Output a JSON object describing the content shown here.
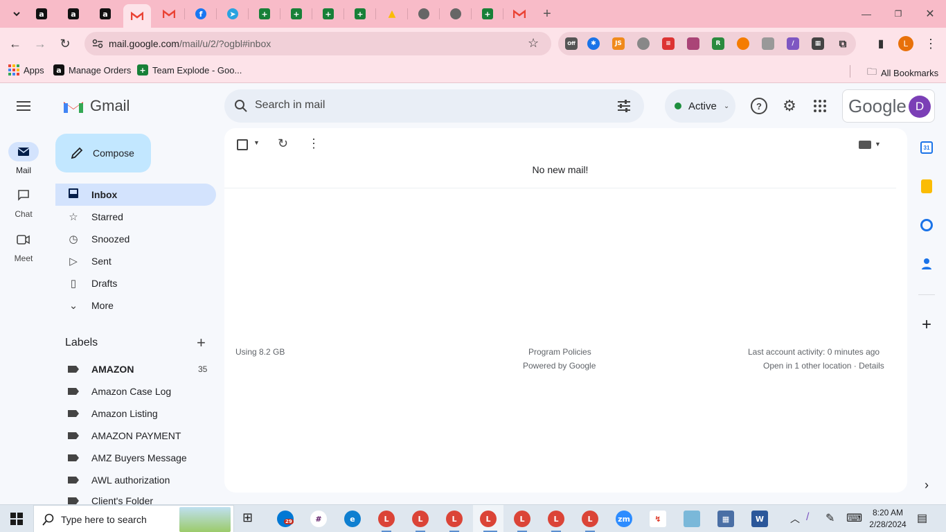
{
  "browser": {
    "tab_new": "+",
    "tab_letters": {
      "amazon": "a",
      "facebook": "f",
      "sheets": "+",
      "drive": "▲"
    },
    "omnibox": {
      "host": "mail.google.com",
      "path": "/mail/u/2/?ogbl#inbox"
    },
    "bookmarks": [
      {
        "label": "Apps"
      },
      {
        "label": "Manage Orders"
      },
      {
        "label": "Team Explode - Goo..."
      }
    ],
    "all_bookmarks": "All Bookmarks",
    "profile_initial": "L",
    "ext_off_label": "Off",
    "ext_js_label": "JS"
  },
  "gmail": {
    "app_name": "Gmail",
    "search_placeholder": "Search in mail",
    "status": "Active",
    "google_wordmark": "Google",
    "account_initial": "D",
    "compose": "Compose",
    "rail": [
      {
        "label": "Mail"
      },
      {
        "label": "Chat"
      },
      {
        "label": "Meet"
      }
    ],
    "nav": [
      {
        "label": "Inbox"
      },
      {
        "label": "Starred"
      },
      {
        "label": "Snoozed"
      },
      {
        "label": "Sent"
      },
      {
        "label": "Drafts"
      },
      {
        "label": "More"
      }
    ],
    "labels_title": "Labels",
    "labels": [
      {
        "label": "AMAZON",
        "count": "35"
      },
      {
        "label": "Amazon Case Log"
      },
      {
        "label": "Amazon Listing"
      },
      {
        "label": "AMAZON PAYMENT"
      },
      {
        "label": "AMZ Buyers Message"
      },
      {
        "label": "AWL authorization"
      },
      {
        "label": "Client's Folder"
      }
    ],
    "empty_message": "No new mail!",
    "storage": "Using 8.2 GB",
    "program_policies": "Program Policies",
    "powered_by": "Powered by Google",
    "last_activity": "Last account activity: 0 minutes ago",
    "open_in": "Open in 1 other location · ",
    "details": "Details",
    "calendar_day": "31"
  },
  "taskbar": {
    "search_placeholder": "Type here to search",
    "time": "8:20 AM",
    "date": "2/28/2024",
    "badge_count": "29",
    "chrome_profiles": [
      "L",
      "L",
      "L",
      "L",
      "L",
      "L",
      "L",
      "L"
    ],
    "zoom_label": "zm",
    "word_label": "W"
  },
  "colors": {
    "chrome_bg": "#f8bbc8",
    "gmail_accent": "#d3e3fd",
    "compose": "#c2e7ff",
    "account": "#7b3fb6",
    "profile": "#e8710a"
  }
}
